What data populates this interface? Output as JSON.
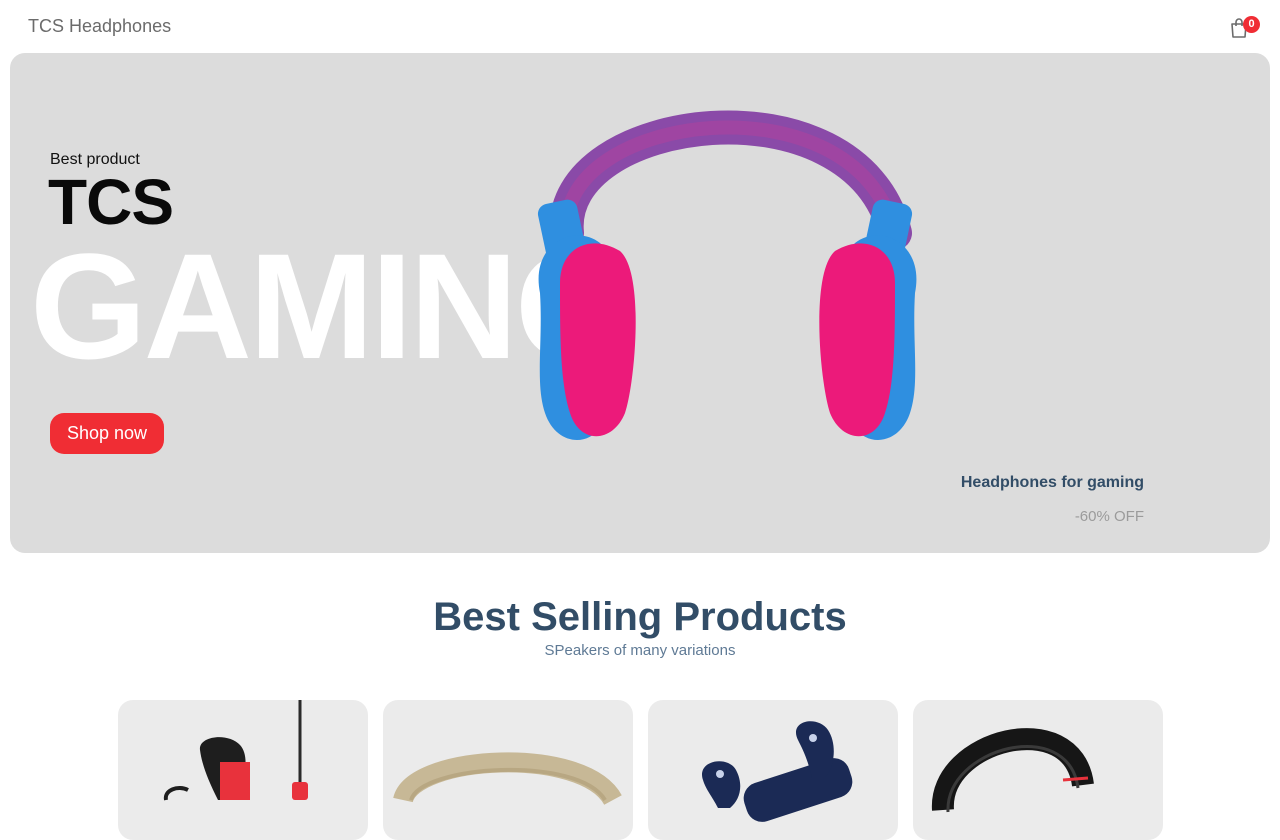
{
  "navbar": {
    "brand": "TCS Headphones",
    "cart_count": "0"
  },
  "hero": {
    "small_text": "Best product",
    "mid_text": "TCS",
    "large_text": "GAMING",
    "button_label": "Shop now",
    "desc_title": "Headphones for gaming",
    "desc_text": "-60% OFF",
    "image_icon": "headphones-icon"
  },
  "products": {
    "title": "Best Selling Products",
    "subtitle": "SPeakers of many variations",
    "items": [
      {
        "icon": "earphones-icon"
      },
      {
        "icon": "headphones-icon"
      },
      {
        "icon": "earbuds-icon"
      },
      {
        "icon": "headphones-icon"
      }
    ]
  },
  "colors": {
    "accent": "#f02d34",
    "heading": "#324d67",
    "hero_bg": "#dcdcdc",
    "card_bg": "#ebebeb"
  }
}
